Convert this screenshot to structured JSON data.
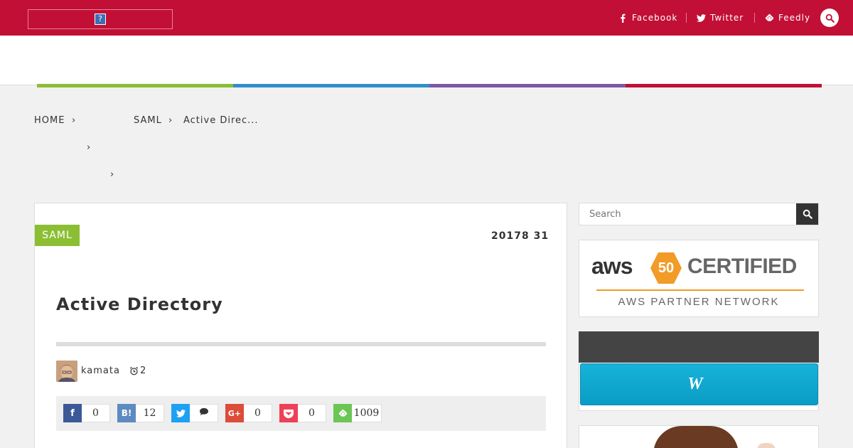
{
  "header": {
    "logo_glyph": "?",
    "social": {
      "facebook": "Facebook",
      "twitter": "Twitter",
      "feedly": "Feedly"
    }
  },
  "nav": {
    "items": [
      {
        "label": "",
        "color": "#8cbe34"
      },
      {
        "label": "",
        "color": "#2f8fc9"
      },
      {
        "label": "",
        "color": "#7b59a6"
      },
      {
        "label": "",
        "color": "#c20f35"
      }
    ]
  },
  "breadcrumb": {
    "home": "HOME",
    "sep": "›",
    "level2": "",
    "saml": "SAML",
    "current": " Active Direc..."
  },
  "article": {
    "category": "SAML",
    "date": "20178 31",
    "title": " Active Directory",
    "author": "kamata",
    "read_time": " 2 ",
    "share": {
      "facebook": {
        "icon": "f",
        "count": "0",
        "color": "#3b5998"
      },
      "hatena": {
        "icon": "B!",
        "count": "12",
        "color": "#5d8ac1"
      },
      "twitter": {
        "icon": "t",
        "count": "",
        "color": "#1da1f2"
      },
      "gplus": {
        "icon": "G+",
        "count": "0",
        "color": "#dd4b39"
      },
      "pocket": {
        "icon": "p",
        "count": "0",
        "color": "#ee4056"
      },
      "feedly": {
        "icon": "f",
        "count": "1009",
        "color": "#6cc655"
      }
    }
  },
  "sidebar": {
    "search_placeholder": "Search",
    "aws": {
      "word": "aws",
      "badge": "50",
      "certified": "CERTIFIED",
      "partner": "AWS PARTNER NETWORK"
    },
    "widget_title": "",
    "widget_button": ""
  },
  "colors": {
    "brand": "#c20f35",
    "category_green": "#8cbe34"
  }
}
